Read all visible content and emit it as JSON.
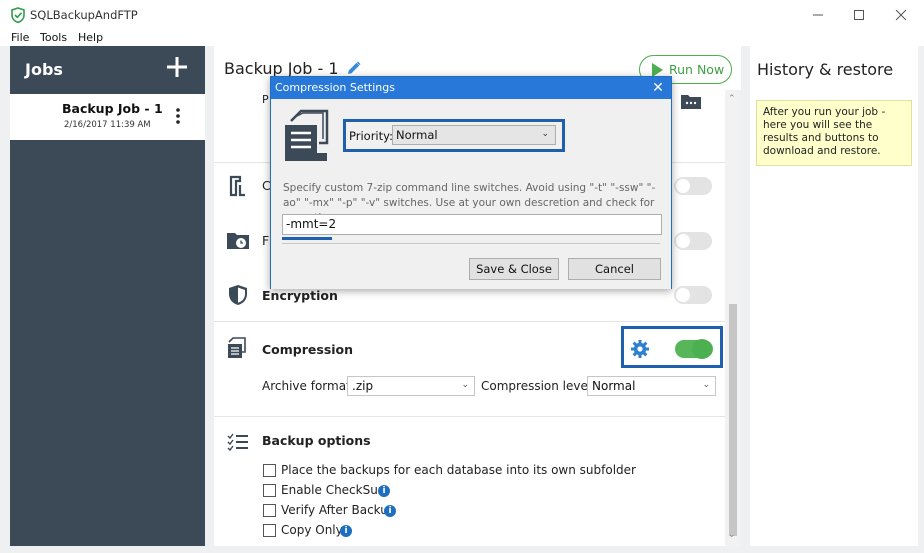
{
  "window": {
    "title": "SQLBackupAndFTP",
    "menu": [
      "File",
      "Tools",
      "Help"
    ]
  },
  "jobs": {
    "title": "Jobs",
    "items": [
      {
        "name": "Backup Job - 1",
        "date": "2/16/2017 11:39 AM"
      }
    ]
  },
  "main": {
    "title": "Backup Job - 1",
    "run_label": "Run Now",
    "rows": {
      "row1_partial": "P",
      "row2_partial": "C",
      "row3_partial": "F",
      "encryption": "Encryption",
      "compression": "Compression",
      "backup_options": "Backup options"
    },
    "compression": {
      "archive_format_label": "Archive format:",
      "archive_format_value": ".zip",
      "level_label": "Compression level:",
      "level_value": "Normal",
      "enabled": true
    },
    "backup_options": [
      {
        "label": "Place the backups for each database into its own subfolder",
        "info": false,
        "checked": false
      },
      {
        "label": "Enable CheckSum",
        "info": true,
        "checked": false
      },
      {
        "label": "Verify After Backup",
        "info": true,
        "checked": false
      },
      {
        "label": "Copy Only",
        "info": true,
        "checked": false
      }
    ]
  },
  "history": {
    "title": "History & restore",
    "note": "After you run your job - here you will see the results and buttons to download and restore."
  },
  "dialog": {
    "title": "Compression Settings",
    "priority_label": "Priority:",
    "priority_value": "Normal",
    "help_text": "Specify custom 7-zip command line switches. Avoid using \"-t\" \"-ssw\" \"-ao\" \"-mx\" \"-p\" \"-v\" switches. Use at your own descretion and check for exceptions.",
    "switches_value": "-mmt=2",
    "save_label": "Save & Close",
    "cancel_label": "Cancel"
  },
  "colors": {
    "sidebar": "#3c4a58",
    "accent_green": "#4caf50",
    "dialog_blue": "#2778d8",
    "highlight_blue": "#1f5fb0",
    "note_yellow": "#ffffcc"
  }
}
